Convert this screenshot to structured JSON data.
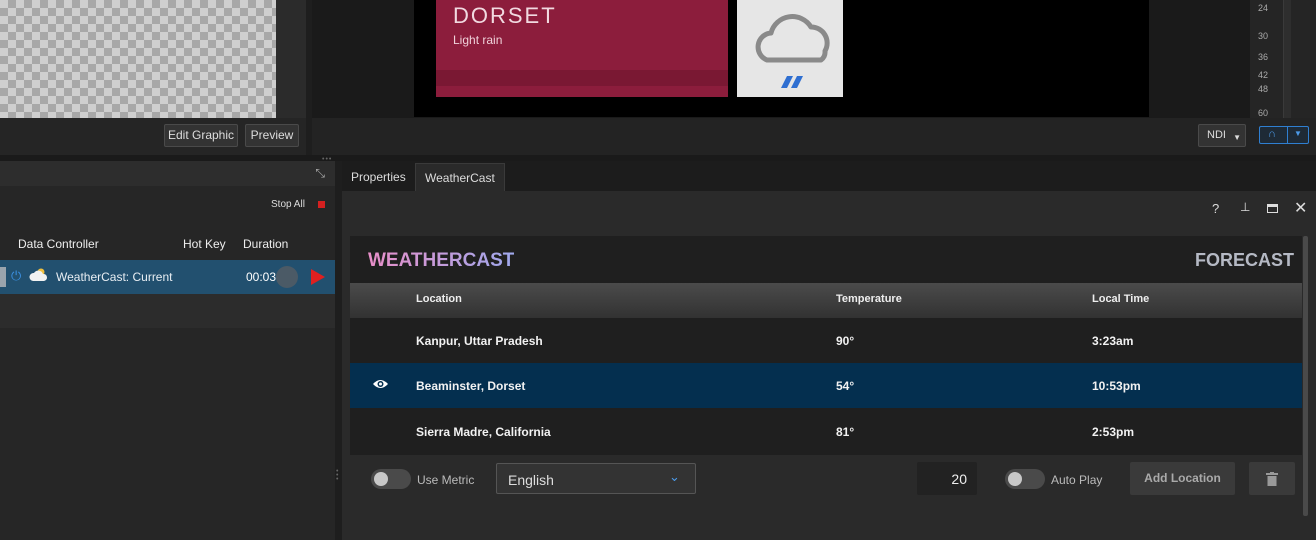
{
  "preview": {
    "edit_graphic_label": "Edit Graphic",
    "preview_label": "Preview"
  },
  "program": {
    "card_title": "DORSET",
    "card_subtitle": "Light rain",
    "weather_icon": "rain-cloud-icon",
    "output_select": "NDI",
    "meter_ticks": [
      "24",
      "30",
      "36",
      "42",
      "48",
      "60"
    ],
    "colors": {
      "card": "#8c1d3c",
      "rain": "#2f6fd1"
    }
  },
  "data_controller": {
    "stop_all_label": "Stop All",
    "columns": {
      "name": "Data Controller",
      "hotkey": "Hot Key",
      "duration": "Duration"
    },
    "rows": [
      {
        "name": "WeatherCast: Current",
        "duration": "00:03"
      }
    ]
  },
  "tabs": [
    {
      "label": "Properties"
    },
    {
      "label": "WeatherCast"
    }
  ],
  "weathercast": {
    "logo": "WEATHERCAST",
    "mode": "FORECAST",
    "headers": {
      "location": "Location",
      "temperature": "Temperature",
      "local_time": "Local Time"
    },
    "rows": [
      {
        "location": "Kanpur, Uttar Pradesh",
        "temperature": "90°",
        "local_time": "3:23am",
        "selected": false
      },
      {
        "location": "Beaminster, Dorset",
        "temperature": "54°",
        "local_time": "10:53pm",
        "selected": true
      },
      {
        "location": "Sierra Madre, California",
        "temperature": "81°",
        "local_time": "2:53pm",
        "selected": false
      }
    ],
    "use_metric_label": "Use Metric",
    "use_metric": false,
    "units_select": "English",
    "interval_value": "20",
    "auto_play_label": "Auto Play",
    "auto_play": false,
    "add_location_label": "Add Location"
  }
}
